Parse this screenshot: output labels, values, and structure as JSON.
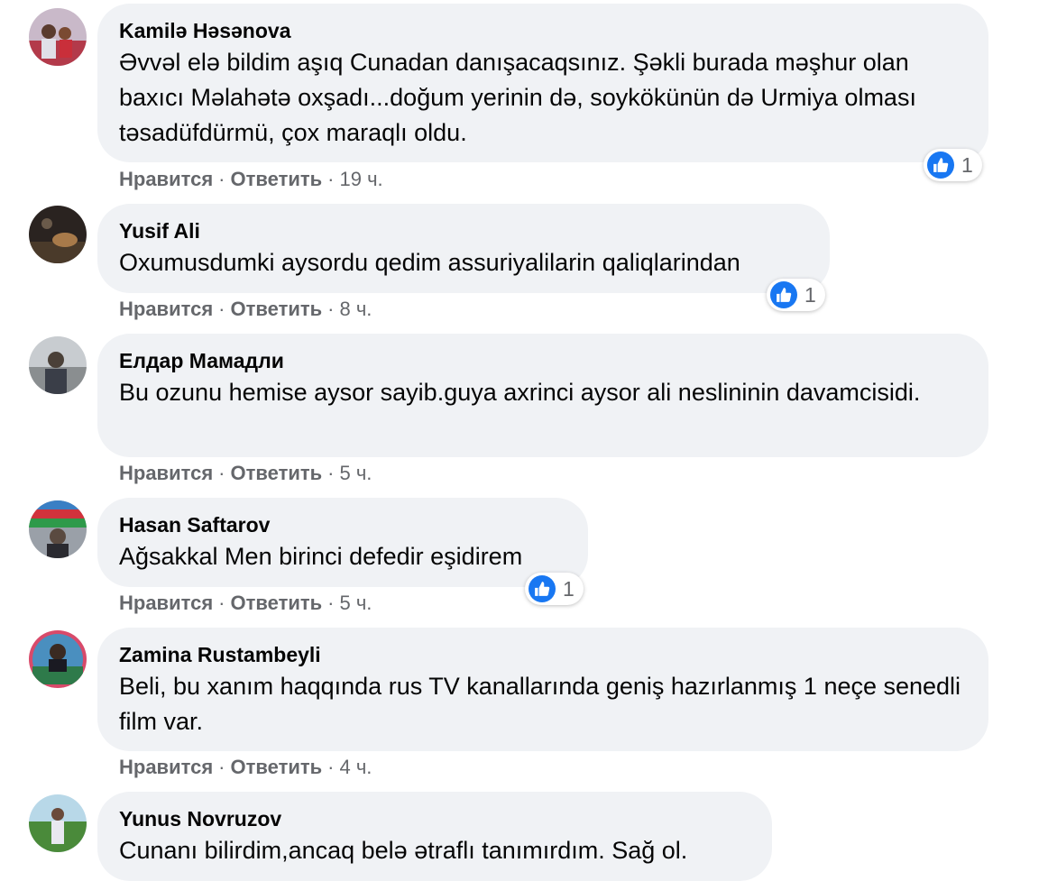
{
  "actions": {
    "like": "Нравится",
    "reply": "Ответить",
    "separator": "·"
  },
  "comments": [
    {
      "author": "Kamilə Həsənova",
      "text": "Əvvəl elə bildim aşıq Cunadan danışacaqsınız. Şəkli burada məşhur olan baxıcı Məlahətə oxşadı...doğum yerinin də, soykökünün də Urmiya olması təsadüfdürmü, çox maraqlı oldu.",
      "time": "19 ч.",
      "reactions": "1"
    },
    {
      "author": "Yusif Ali",
      "text": "Oxumusdumki aysordu qedim assuriyalilarin qaliqlarindan",
      "time": "8 ч.",
      "reactions": "1"
    },
    {
      "author": "Елдар Мамадли",
      "text": "Bu ozunu hemise aysor sayib.guya axrinci aysor ali neslininin davamcisidi.",
      "time": "5 ч."
    },
    {
      "author": "Hasan Saftarov",
      "text": "Ağsakkal Men birinci defedir eşidirem",
      "time": "5 ч.",
      "reactions": "1"
    },
    {
      "author": "Zamina Rustambeyli",
      "text": "Beli, bu xanım haqqında rus TV kanallarında geniş hazırlanmış 1 neçe senedli film var.",
      "time": "4 ч."
    },
    {
      "author": "Yunus Novruzov",
      "text": "Cunanı bilirdim,ancaq belə ətraflı tanımırdım. Sağ ol."
    }
  ],
  "colors": {
    "bubble": "#f0f2f5",
    "meta": "#65676b",
    "like": "#1877f2"
  }
}
